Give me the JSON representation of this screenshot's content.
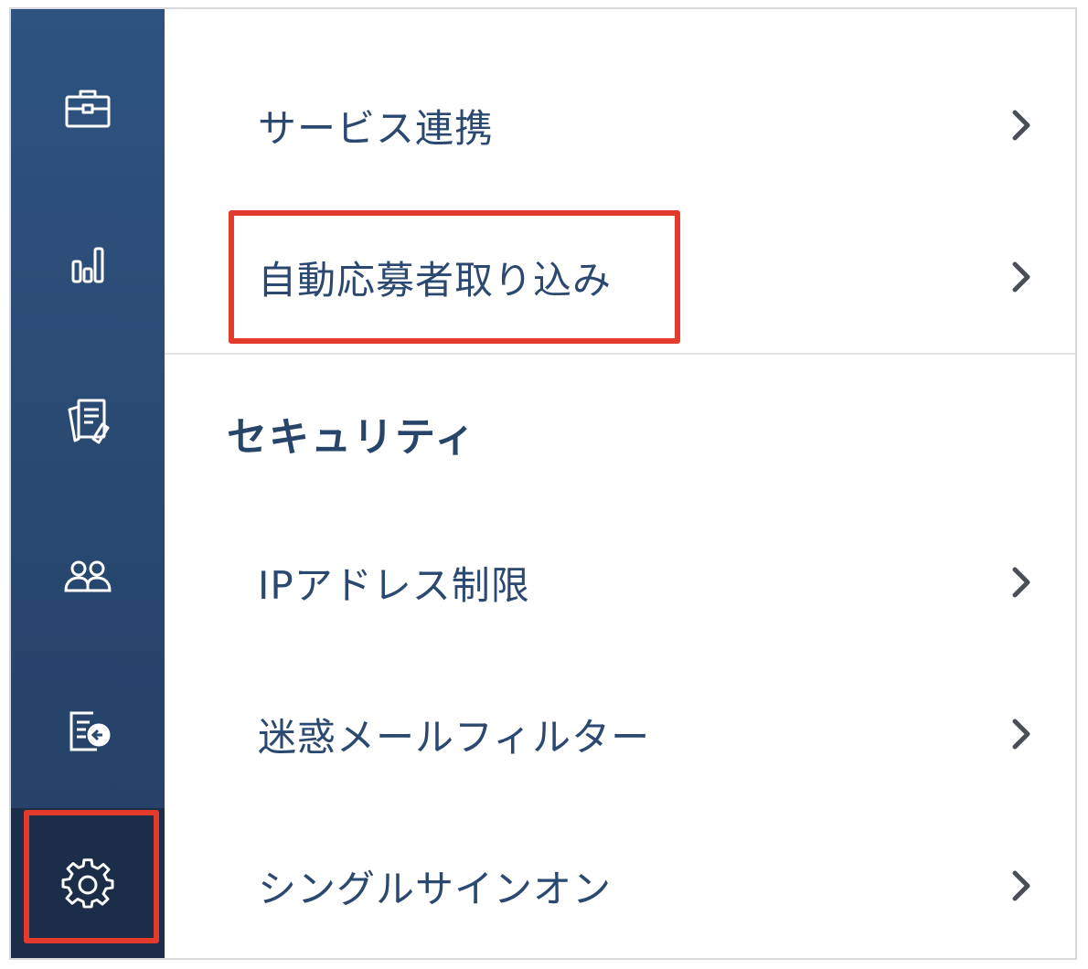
{
  "colors": {
    "sidebar_bg": "#2a4a72",
    "sidebar_active_bg": "#1c2d4a",
    "text": "#2b4870",
    "highlight_border": "#e33a2c",
    "chevron": "#4a4f57"
  },
  "sidebar": {
    "items": [
      {
        "icon": "briefcase-icon"
      },
      {
        "icon": "bar-chart-icon"
      },
      {
        "icon": "documents-icon"
      },
      {
        "icon": "users-icon"
      },
      {
        "icon": "export-list-icon"
      },
      {
        "icon": "gear-icon",
        "active": true
      }
    ]
  },
  "menu": {
    "integrations": [
      {
        "label": "サービス連携"
      },
      {
        "label": "自動応募者取り込み",
        "highlighted": true
      }
    ],
    "security_title": "セキュリティ",
    "security": [
      {
        "label": "IPアドレス制限"
      },
      {
        "label": "迷惑メールフィルター"
      },
      {
        "label": "シングルサインオン"
      }
    ]
  }
}
